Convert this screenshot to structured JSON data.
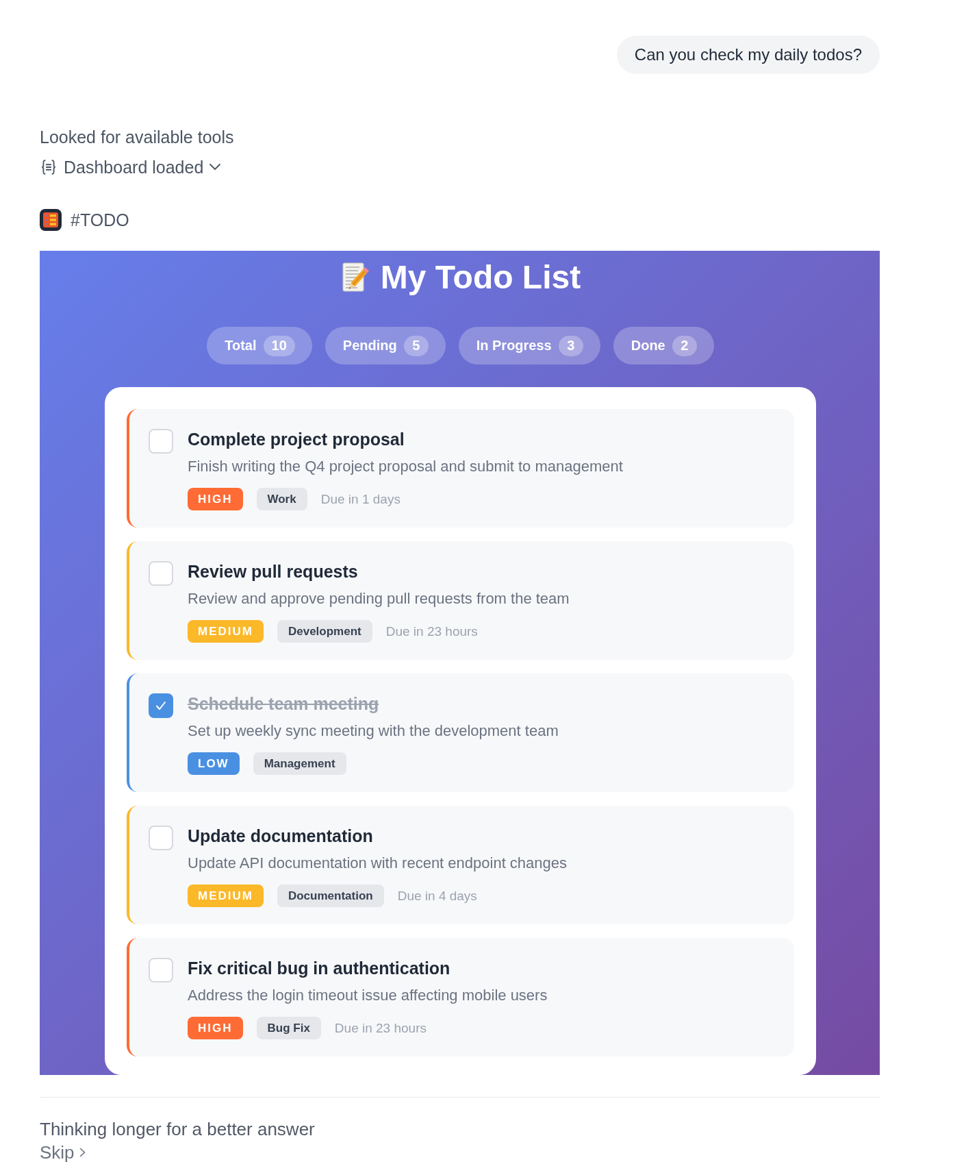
{
  "user_message": {
    "text": "Can you check my daily todos?"
  },
  "activity": {
    "status": "Looked for available tools",
    "result": {
      "label": "Dashboard loaded",
      "expanded": false
    }
  },
  "app": {
    "name": "#TODO"
  },
  "dashboard": {
    "title": "My Todo List",
    "stats": [
      {
        "label": "Total",
        "count": "10"
      },
      {
        "label": "Pending",
        "count": "5"
      },
      {
        "label": "In Progress",
        "count": "3"
      },
      {
        "label": "Done",
        "count": "2"
      }
    ],
    "todos": [
      {
        "title": "Complete project proposal",
        "description": "Finish writing the Q4 project proposal and submit to management",
        "completed": false,
        "priority": {
          "label": "HIGH",
          "color": "#ff6b35"
        },
        "category": "Work",
        "due": "Due in 1 days"
      },
      {
        "title": "Review pull requests",
        "description": "Review and approve pending pull requests from the team",
        "completed": false,
        "priority": {
          "label": "MEDIUM",
          "color": "#fbb829"
        },
        "category": "Development",
        "due": "Due in 23 hours"
      },
      {
        "title": "Schedule team meeting",
        "description": "Set up weekly sync meeting with the development team",
        "completed": true,
        "priority": {
          "label": "LOW",
          "color": "#4a90e2"
        },
        "category": "Management"
      },
      {
        "title": "Update documentation",
        "description": "Update API documentation with recent endpoint changes",
        "completed": false,
        "priority": {
          "label": "MEDIUM",
          "color": "#fbb829"
        },
        "category": "Documentation",
        "due": "Due in 4 days"
      },
      {
        "title": "Fix critical bug in authentication",
        "description": "Address the login timeout issue affecting mobile users",
        "completed": false,
        "priority": {
          "label": "HIGH",
          "color": "#ff6b35"
        },
        "category": "Bug Fix",
        "due": "Due in 23 hours"
      }
    ]
  },
  "thinking": {
    "text": "Thinking longer for a better answer",
    "skip": "Skip"
  }
}
